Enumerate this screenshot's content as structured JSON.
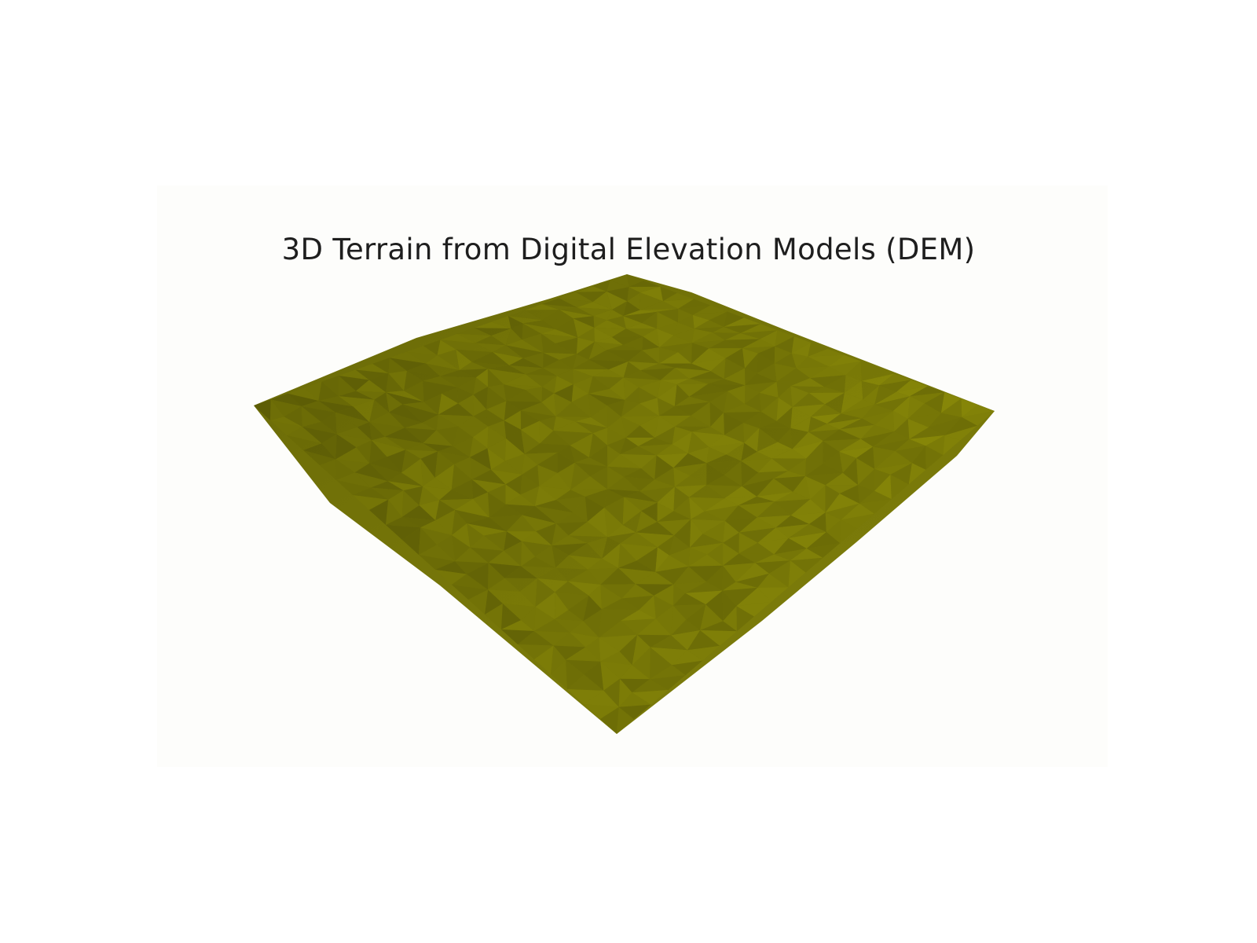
{
  "scene": {
    "title": "3D Terrain from Digital Elevation Models (DEM)",
    "colors": {
      "background": "#ffffff",
      "render_background": "#fdfdfb",
      "terrain_base": "#7a7a08",
      "terrain_light": "#8f8f10",
      "terrain_dark": "#5f5f06",
      "title_text": "#1e1e1e"
    },
    "surface": {
      "type": "triangulated-mesh",
      "shading": "flat"
    }
  }
}
